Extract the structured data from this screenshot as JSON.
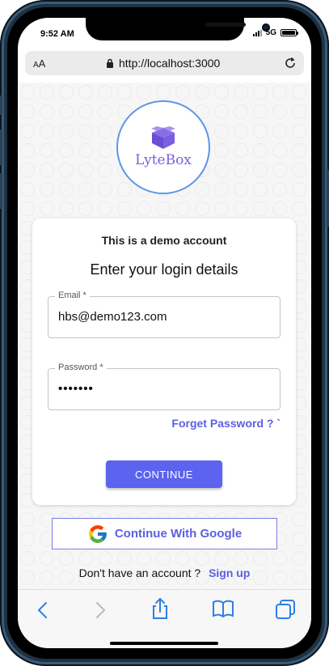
{
  "status": {
    "time": "9:52 AM",
    "network": "5G"
  },
  "browser": {
    "text_size_label": "AA",
    "url": "http://localhost:3000"
  },
  "brand": {
    "logo_text": "LyteBox"
  },
  "login": {
    "demo_notice": "This is a demo account",
    "heading": "Enter your login details",
    "email_label": "Email *",
    "email_value": "hbs@demo123.com",
    "password_label": "Password *",
    "password_mask": "•••••••",
    "forgot_label": "Forget Password ? `",
    "continue_label": "CONTINUE"
  },
  "google": {
    "label": "Continue With Google"
  },
  "signup": {
    "prompt": "Don't have an account ?",
    "link": "Sign up"
  },
  "colors": {
    "accent": "#5b63ef",
    "link": "#5b5fe0",
    "frame": "#1d3245",
    "ios_blue": "#2f7ee8"
  },
  "toolbar_icons": [
    "back-icon",
    "forward-icon",
    "share-icon",
    "bookmarks-icon",
    "tabs-icon"
  ]
}
